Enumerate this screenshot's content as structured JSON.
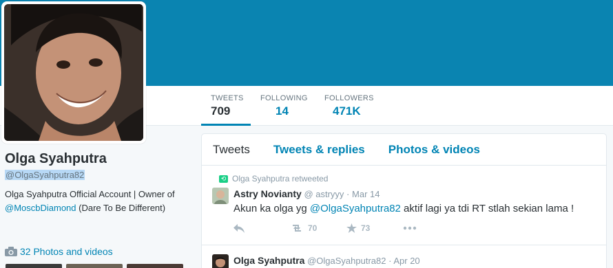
{
  "profile": {
    "name": "Olga Syahputra",
    "handle": "@OlgaSyahputra82",
    "bio_prefix": "Olga Syahputra Official Account | Owner of ",
    "bio_link": "@MoscbDiamond",
    "bio_suffix": " (Dare To Be Different)",
    "photos_label": "32 Photos and videos"
  },
  "stats": [
    {
      "label": "TWEETS",
      "value": "709"
    },
    {
      "label": "FOLLOWING",
      "value": "14"
    },
    {
      "label": "FOLLOWERS",
      "value": "471K"
    }
  ],
  "tabs": [
    "Tweets",
    "Tweets & replies",
    "Photos & videos"
  ],
  "tweets": [
    {
      "context": "Olga Syahputra retweeted",
      "name": "Astry Novianty",
      "handle": "@ astryyy",
      "date": "Mar 14",
      "text_prefix": "Akun ka olga yg ",
      "text_link": "@OlgaSyahputra82",
      "text_suffix": " aktif lagi ya tdi RT stlah sekian lama !",
      "retweets": "70",
      "favorites": "73"
    },
    {
      "name": "Olga Syahputra",
      "handle": "@OlgaSyahputra82",
      "date": "Apr 20"
    }
  ],
  "colors": {
    "banner": "#0a84b1",
    "link": "#0084b4",
    "retweet_badge": "#19cf86"
  }
}
